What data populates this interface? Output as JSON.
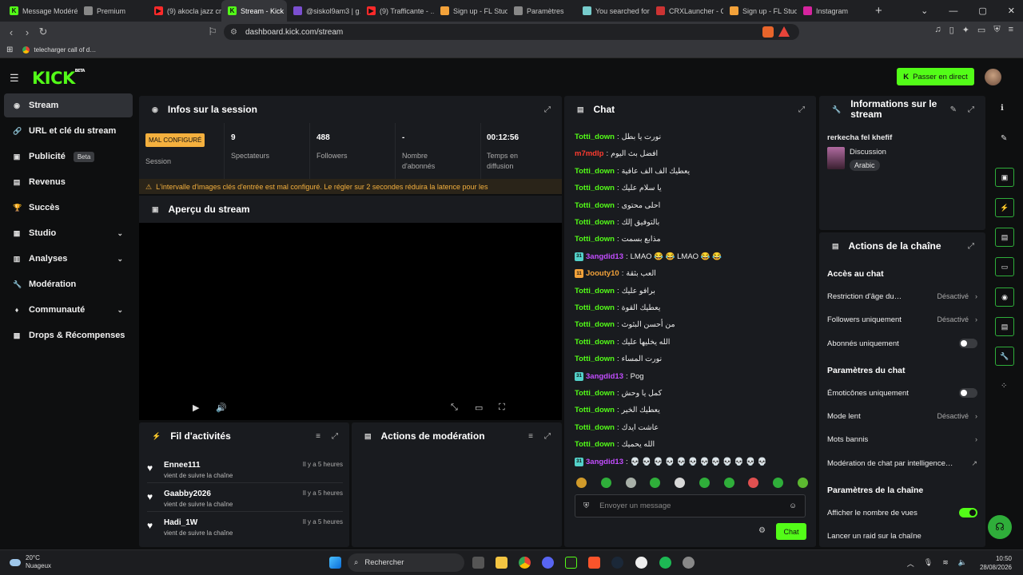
{
  "browser": {
    "tabs": [
      {
        "title": "Message Modéré…",
        "fav": "K",
        "color": "#53fc18"
      },
      {
        "title": "Premium",
        "fav": "",
        "color": "#888"
      },
      {
        "title": "(9) akocla jazz cr…",
        "fav": "▶",
        "color": "#ff2a2a"
      },
      {
        "title": "Stream - Kick",
        "fav": "K",
        "color": "#53fc18",
        "active": true
      },
      {
        "title": "@siskol9am3 | g…",
        "fav": "",
        "color": "#7b4fd0"
      },
      {
        "title": "(9) Trafficante - …",
        "fav": "▶",
        "color": "#ff2a2a"
      },
      {
        "title": "Sign up - FL Stud…",
        "fav": "",
        "color": "#f3a23a"
      },
      {
        "title": "Paramètres",
        "fav": "",
        "color": "#888"
      },
      {
        "title": "You searched for …",
        "fav": "",
        "color": "#7cc"
      },
      {
        "title": "CRXLauncher - C…",
        "fav": "",
        "color": "#c33"
      },
      {
        "title": "Sign up - FL Stud…",
        "fav": "",
        "color": "#f3a23a"
      },
      {
        "title": "Instagram",
        "fav": "",
        "color": "#d6249f"
      }
    ],
    "url": "dashboard.kick.com/stream",
    "bookmark": "telecharger call of d…"
  },
  "header": {
    "logo": "KICK",
    "logo_beta": "BETA",
    "go_live": "Passer en direct"
  },
  "sidebar": {
    "items": [
      {
        "label": "Stream",
        "icon": "radio-icon",
        "glyph": "◉",
        "active": true
      },
      {
        "label": "URL et clé du stream",
        "icon": "link-icon",
        "glyph": "🔗"
      },
      {
        "label": "Publicité",
        "icon": "ad-icon",
        "glyph": "▣",
        "badge": "Beta"
      },
      {
        "label": "Revenus",
        "icon": "revenue-icon",
        "glyph": "▤"
      },
      {
        "label": "Succès",
        "icon": "trophy-icon",
        "glyph": "🏆"
      },
      {
        "label": "Studio",
        "icon": "studio-icon",
        "glyph": "▦",
        "chevron": true
      },
      {
        "label": "Analyses",
        "icon": "chart-icon",
        "glyph": "▥",
        "chevron": true
      },
      {
        "label": "Modération",
        "icon": "wrench-icon",
        "glyph": "🔧"
      },
      {
        "label": "Communauté",
        "icon": "community-icon",
        "glyph": "♦",
        "chevron": true
      },
      {
        "label": "Drops & Récompenses",
        "icon": "gift-icon",
        "glyph": "▩"
      }
    ]
  },
  "session": {
    "title": "Infos sur la session",
    "status_badge": "MAL CONFIGURÉ",
    "status_label": "Session",
    "stats": [
      {
        "value": "9",
        "label": "Spectateurs"
      },
      {
        "value": "488",
        "label": "Followers"
      },
      {
        "value": "-",
        "label": "Nombre d'abonnés"
      },
      {
        "value": "00:12:56",
        "label": "Temps en diffusion"
      }
    ],
    "warning": "L'intervalle d'images clés d'entrée est mal configuré. Le régler sur 2 secondes réduira la latence pour les"
  },
  "preview": {
    "title": "Aperçu du stream"
  },
  "activity": {
    "title": "Fil d'activités",
    "items": [
      {
        "name": "Ennee111",
        "text": "vient de suivre la chaîne",
        "time": "Il y a 5 heures"
      },
      {
        "name": "Gaabby2026",
        "text": "vient de suivre la chaîne",
        "time": "Il y a 5 heures"
      },
      {
        "name": "Hadi_1W",
        "text": "vient de suivre la chaîne",
        "time": "Il y a 5 heures"
      }
    ]
  },
  "moderation": {
    "title": "Actions de modération"
  },
  "chat": {
    "title": "Chat",
    "messages": [
      {
        "user": "Totti_down",
        "color": "#53fc18",
        "text": "نورت يا بطل"
      },
      {
        "user": "m7mdlp",
        "color": "#ff3b30",
        "text": "افضل بث اليوم"
      },
      {
        "user": "Totti_down",
        "color": "#53fc18",
        "text": "يعطيك الف الف عافية"
      },
      {
        "user": "Totti_down",
        "color": "#53fc18",
        "text": "يا سلام عليك"
      },
      {
        "user": "Totti_down",
        "color": "#53fc18",
        "text": "احلى محتوى"
      },
      {
        "user": "Totti_down",
        "color": "#53fc18",
        "text": "بالتوفيق إلك"
      },
      {
        "user": "Totti_down",
        "color": "#53fc18",
        "text": "مذابع بسمت"
      },
      {
        "user": "3angdid13",
        "color": "#c34dff",
        "badge": "31",
        "badgecolor": "#53d1c9",
        "text": "LMAO 😂 😂 LMAO 😂 😂"
      },
      {
        "user": "Joouty10",
        "color": "#f3a23a",
        "badge": "11",
        "badgecolor": "#f3a23a",
        "text": "العب بثقة"
      },
      {
        "user": "Totti_down",
        "color": "#53fc18",
        "text": "برافو عليك"
      },
      {
        "user": "Totti_down",
        "color": "#53fc18",
        "text": "يعطيك القوة"
      },
      {
        "user": "Totti_down",
        "color": "#53fc18",
        "text": "من أحسن البثوث"
      },
      {
        "user": "Totti_down",
        "color": "#53fc18",
        "text": "الله يخليها عليك"
      },
      {
        "user": "Totti_down",
        "color": "#53fc18",
        "text": "نورت المساء"
      },
      {
        "user": "3angdid13",
        "color": "#c34dff",
        "badge": "31",
        "badgecolor": "#53d1c9",
        "text": "Pog"
      },
      {
        "user": "Totti_down",
        "color": "#53fc18",
        "text": "كمل يا وحش"
      },
      {
        "user": "Totti_down",
        "color": "#53fc18",
        "text": "يعطيك الخير"
      },
      {
        "user": "Totti_down",
        "color": "#53fc18",
        "text": "عاشت ايدك"
      },
      {
        "user": "Totti_down",
        "color": "#53fc18",
        "text": "الله يحميك"
      },
      {
        "user": "3angdid13",
        "color": "#c34dff",
        "badge": "31",
        "badgecolor": "#53d1c9",
        "text": "💀 💀 💀 💀 💀 💀 💀 💀 💀 💀 💀 💀"
      }
    ],
    "placeholder": "Envoyer un message",
    "send": "Chat"
  },
  "info": {
    "title": "Informations sur le stream",
    "stream_title": "rerkecha fel khefif",
    "category": "Discussion",
    "language": "Arabic"
  },
  "actions": {
    "title": "Actions de la chaîne",
    "section1": "Accès au chat",
    "age": "Restriction d'âge du…",
    "age_val": "Désactivé",
    "followers": "Followers uniquement",
    "followers_val": "Désactivé",
    "subs": "Abonnés uniquement",
    "section2": "Paramètres du chat",
    "emotes": "Émoticônes uniquement",
    "slow": "Mode lent",
    "slow_val": "Désactivé",
    "banned": "Mots bannis",
    "ai_mod": "Modération de chat par intelligence…",
    "section3": "Paramètres de la chaîne",
    "views": "Afficher le nombre de vues",
    "raid": "Lancer un raid sur la chaîne"
  },
  "taskbar": {
    "temp": "20°C",
    "weather": "Nuageux",
    "search": "Rechercher",
    "time": "10:50",
    "date": "28/08/2026"
  }
}
